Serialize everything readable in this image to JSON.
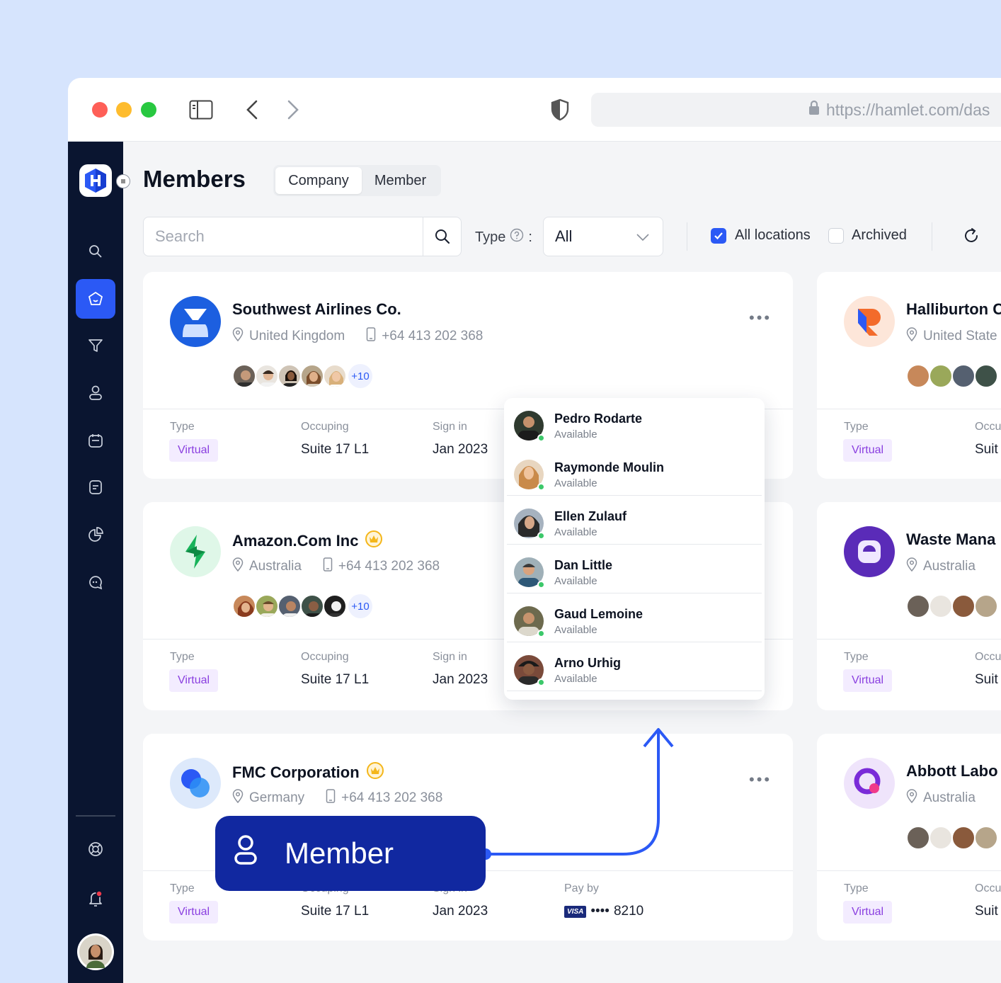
{
  "browser": {
    "url": "https://hamlet.com/das",
    "window_controls": [
      "close",
      "minimize",
      "zoom"
    ],
    "colors": {
      "close": "#fe5f57",
      "minimize": "#febc2e",
      "zoom": "#28c840"
    }
  },
  "header": {
    "title": "Members",
    "tabs": [
      {
        "label": "Company",
        "active": true
      },
      {
        "label": "Member",
        "active": false
      }
    ]
  },
  "filters": {
    "search_placeholder": "Search",
    "type_label": "Type",
    "type_colon": ":",
    "type_value": "All",
    "all_locations": {
      "label": "All locations",
      "checked": true
    },
    "archived": {
      "label": "Archived",
      "checked": false
    }
  },
  "fields": {
    "type": "Type",
    "occuping": "Occuping",
    "sign_in": "Sign in",
    "pay_by": "Pay by"
  },
  "cards": [
    {
      "name": "Southwest Airlines Co.",
      "country": "United Kingdom",
      "phone": "+64 413 202 368",
      "more_count": "+10",
      "type": "Virtual",
      "occuping": "Suite 17 L1",
      "sign_in": "Jan 2023"
    },
    {
      "name": "Amazon.Com Inc",
      "premium": true,
      "country": "Australia",
      "phone": "+64 413 202 368",
      "more_count": "+10",
      "type": "Virtual",
      "occuping": "Suite 17 L1",
      "sign_in": "Jan 2023"
    },
    {
      "name": "FMC Corporation",
      "premium": true,
      "country": "Germany",
      "phone": "+64 413 202 368",
      "type": "Virtual",
      "occuping": "Suite 17 L1",
      "sign_in": "Jan 2023",
      "pay_by_card": "VISA",
      "pay_by_masked": "••••",
      "pay_by_last4": "8210"
    }
  ],
  "right_cards": [
    {
      "name": "Halliburton C",
      "country": "United State",
      "type": "Virtual",
      "occuping_label": "Occu",
      "occuping": "Suit"
    },
    {
      "name": "Waste Mana",
      "country": "Australia",
      "type": "Virtual",
      "occuping_label": "Occu",
      "occuping": "Suit"
    },
    {
      "name": "Abbott Labo",
      "country": "Australia",
      "type": "Virtual",
      "occuping_label": "Occu",
      "occuping": "Suit"
    }
  ],
  "members_dropdown": [
    {
      "name": "Pedro Rodarte",
      "status": "Available"
    },
    {
      "name": "Raymonde Moulin",
      "status": "Available"
    },
    {
      "name": "Ellen Zulauf",
      "status": "Available"
    },
    {
      "name": "Dan Little",
      "status": "Available"
    },
    {
      "name": "Gaud Lemoine",
      "status": "Available"
    },
    {
      "name": "Arno Urhig",
      "status": "Available"
    }
  ],
  "callout": {
    "label": "Member"
  },
  "colors": {
    "accent": "#2b59f5",
    "sidebar": "#0a1530",
    "tag_bg": "#f3ecff",
    "tag_text": "#8a3fe0",
    "callout": "#1128a0",
    "online": "#3cc86a"
  }
}
